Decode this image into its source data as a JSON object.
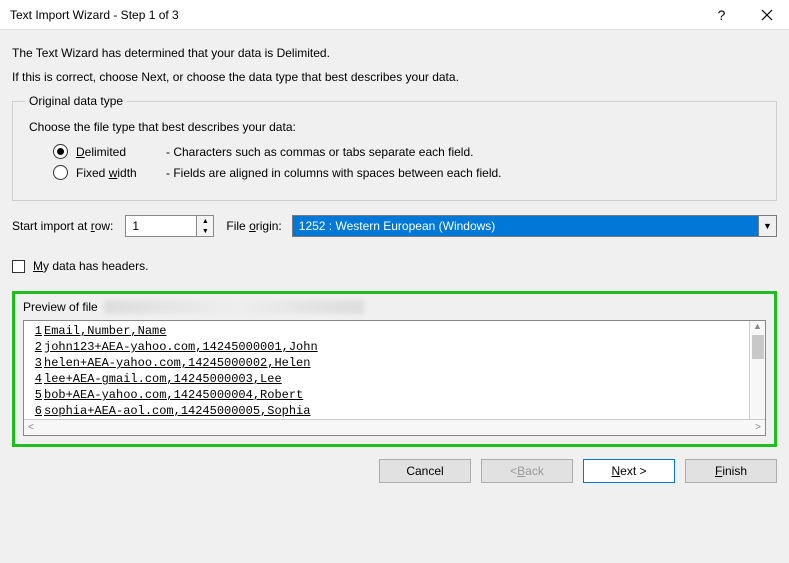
{
  "title": "Text Import Wizard - Step 1 of 3",
  "intro1": "The Text Wizard has determined that your data is Delimited.",
  "intro2": "If this is correct, choose Next, or choose the data type that best describes your data.",
  "group": {
    "legend": "Original data type",
    "choose": "Choose the file type that best describes your data:",
    "delimited": {
      "label_pre": "",
      "label_u": "D",
      "label_post": "elimited",
      "desc": "- Characters such as commas or tabs separate each field."
    },
    "fixed": {
      "label_pre": "Fixed ",
      "label_u": "w",
      "label_post": "idth",
      "desc": "- Fields are aligned in columns with spaces between each field."
    }
  },
  "start_row": {
    "label_pre": "Start import at ",
    "label_u": "r",
    "label_post": "ow:",
    "value": "1"
  },
  "file_origin": {
    "label_pre": "File ",
    "label_u": "o",
    "label_post": "rigin:",
    "value": "1252 : Western European (Windows)"
  },
  "headers": {
    "label_pre": "",
    "label_u": "M",
    "label_post": "y data has headers."
  },
  "preview": {
    "title": "Preview of file",
    "rows": [
      {
        "n": "1",
        "t": "Email,Number,Name"
      },
      {
        "n": "2",
        "t": "john123+AEA-yahoo.com,14245000001,John"
      },
      {
        "n": "3",
        "t": "helen+AEA-yahoo.com,14245000002,Helen"
      },
      {
        "n": "4",
        "t": "lee+AEA-gmail.com,14245000003,Lee"
      },
      {
        "n": "5",
        "t": "bob+AEA-yahoo.com,14245000004,Robert"
      },
      {
        "n": "6",
        "t": "sophia+AEA-aol.com,14245000005,Sophia"
      }
    ]
  },
  "buttons": {
    "cancel": "Cancel",
    "back_pre": "< ",
    "back_u": "B",
    "back_post": "ack",
    "next_u": "N",
    "next_post": "ext >",
    "finish_u": "F",
    "finish_post": "inish"
  }
}
